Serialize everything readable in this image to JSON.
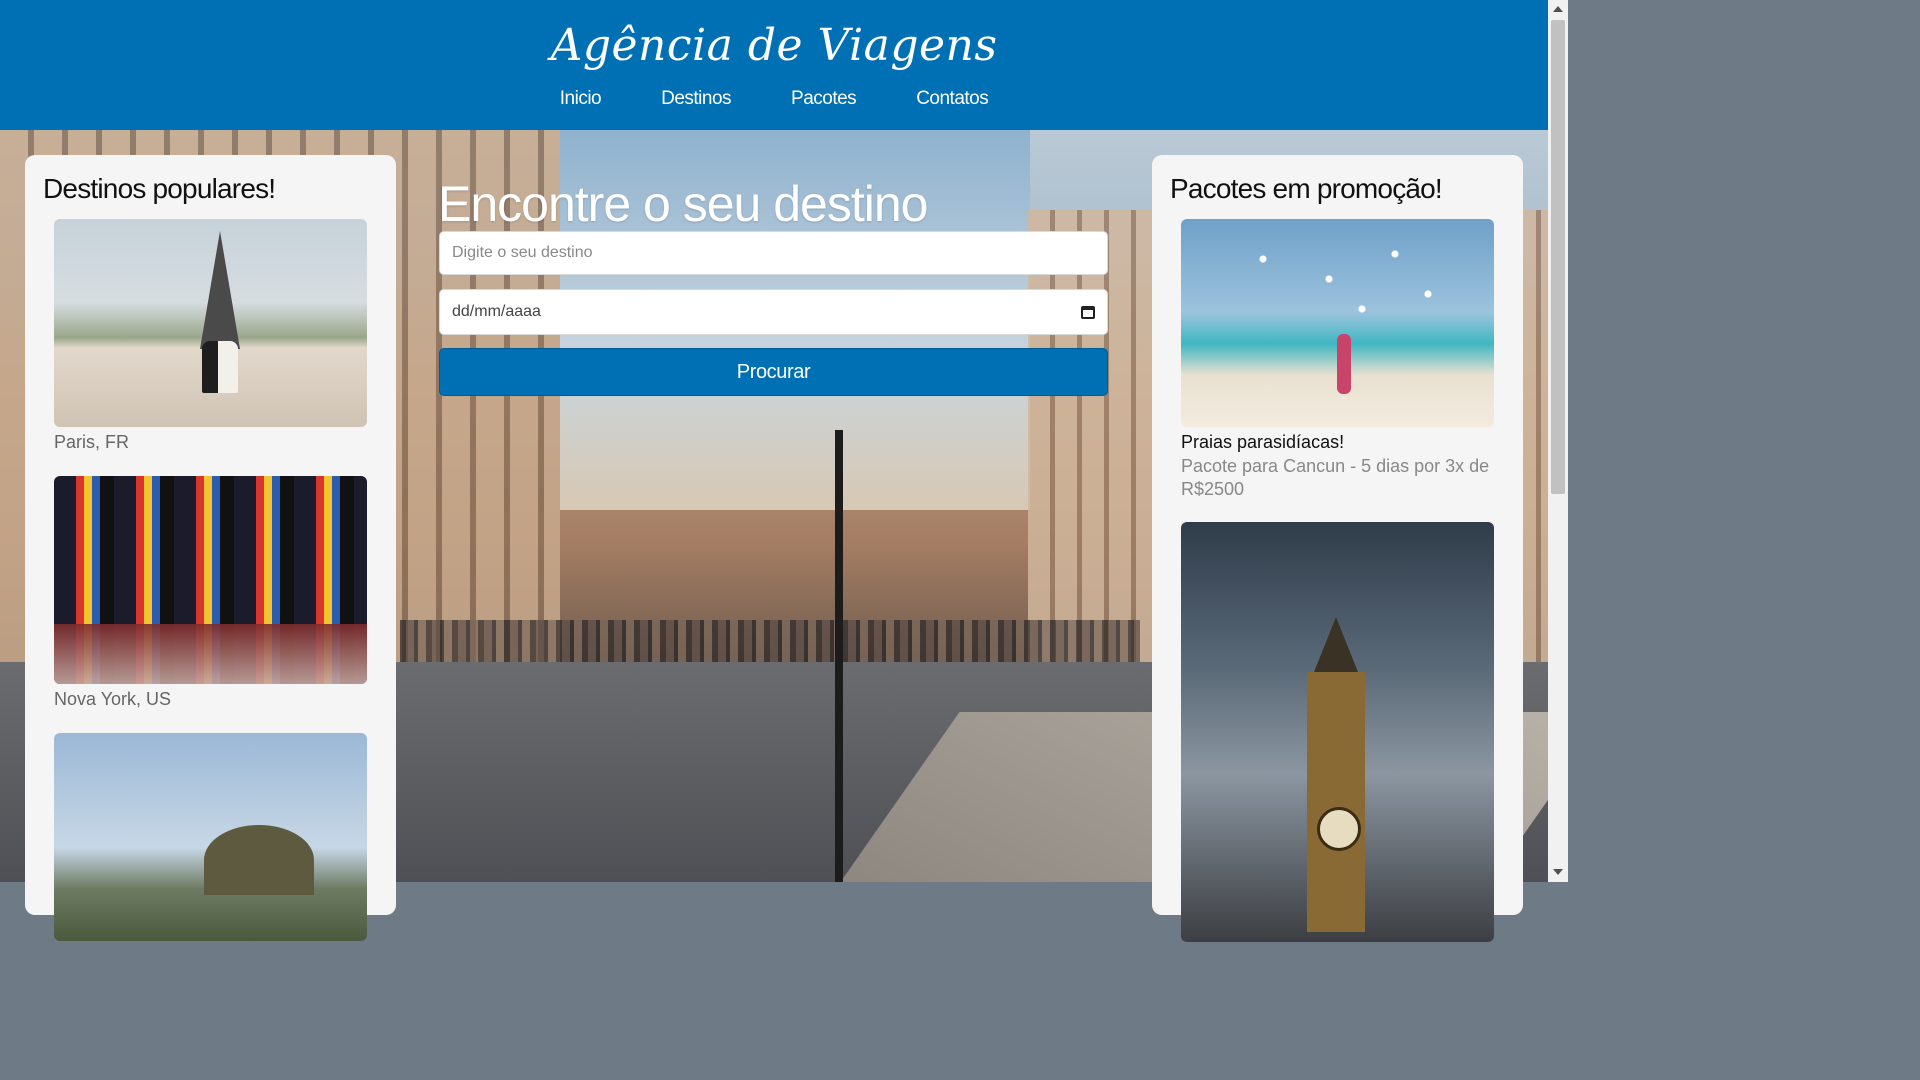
{
  "header": {
    "brand": "Agência de Viagens",
    "nav": [
      "Inicio",
      "Destinos",
      "Pacotes",
      "Contatos"
    ]
  },
  "search": {
    "title": "Encontre o seu destino",
    "destination_placeholder": "Digite o seu destino",
    "date_value": "dd/mm/aaaa",
    "button_label": "Procurar"
  },
  "popular": {
    "title": "Destinos populares!",
    "items": [
      {
        "caption": "Paris, FR"
      },
      {
        "caption": "Nova York, US"
      },
      {
        "caption": ""
      }
    ]
  },
  "promos": {
    "title": "Pacotes em promoção!",
    "items": [
      {
        "title": "Praias parasidíacas!",
        "description": "Pacote para Cancun - 5 dias por 3x de R$2500"
      },
      {
        "title": "",
        "description": ""
      }
    ]
  },
  "colors": {
    "brand_blue": "#0070b5",
    "panel_bg": "#f5f5f5"
  },
  "icons": {
    "date": "calendar-icon"
  }
}
